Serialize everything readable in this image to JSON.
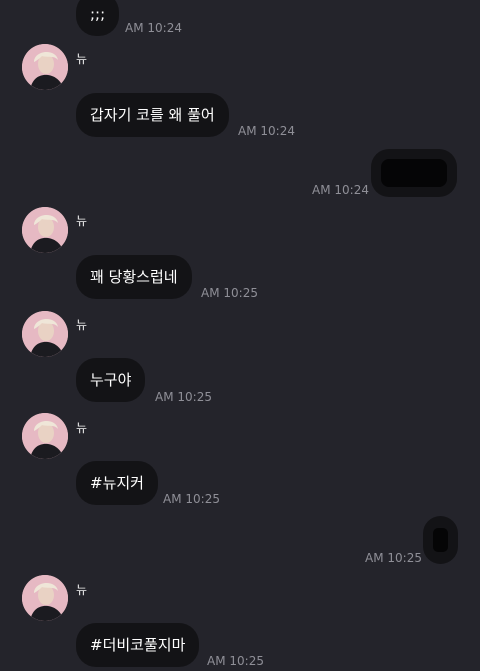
{
  "chat": {
    "messages": [
      {
        "dir": "in",
        "show_avatar": false,
        "text": ";;;",
        "time": "AM 10:24"
      },
      {
        "dir": "in",
        "show_avatar": true,
        "sender": "뉴",
        "text": "갑자기 코를 왜 풀어",
        "time": "AM 10:24"
      },
      {
        "dir": "out",
        "redacted": true,
        "time": "AM 10:24"
      },
      {
        "dir": "in",
        "show_avatar": true,
        "sender": "뉴",
        "text": "꽤 당황스럽네",
        "time": "AM 10:25"
      },
      {
        "dir": "in",
        "show_avatar": true,
        "sender": "뉴",
        "text": "누구야",
        "time": "AM 10:25"
      },
      {
        "dir": "in",
        "show_avatar": true,
        "sender": "뉴",
        "text": "#뉴지커",
        "time": "AM 10:25"
      },
      {
        "dir": "out",
        "redacted": true,
        "time": "AM 10:25"
      },
      {
        "dir": "in",
        "show_avatar": true,
        "sender": "뉴",
        "text": "#더비코풀지마",
        "time": "AM 10:25"
      }
    ]
  },
  "colors": {
    "background": "#24242b",
    "bubble": "#131316",
    "timestamp": "#8f8f97",
    "avatar_bg": "#e6b9c3"
  }
}
